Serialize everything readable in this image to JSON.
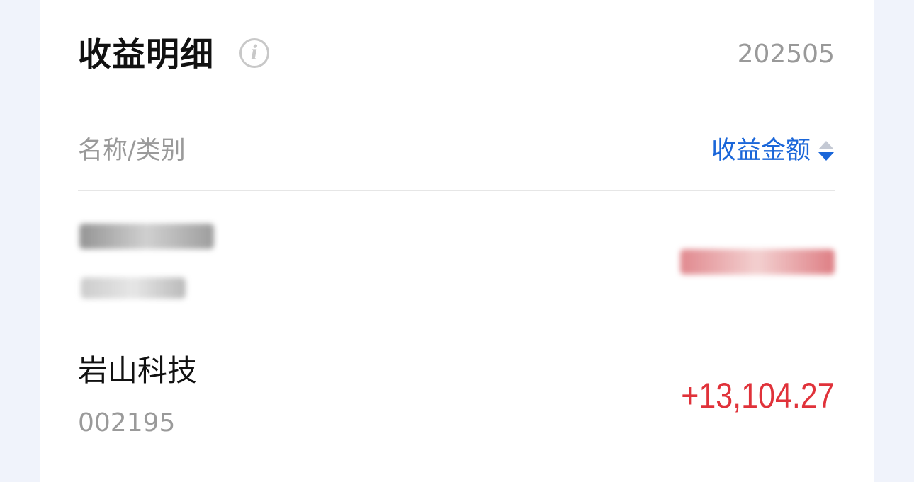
{
  "header": {
    "title": "收益明细",
    "info_icon": "info-icon",
    "period": "202505"
  },
  "columns": {
    "name_label": "名称/类别",
    "amount_label": "收益金额",
    "sort_icon": "sort-icon"
  },
  "rows": [
    {
      "name": "",
      "code": "",
      "value": "",
      "redacted": true
    },
    {
      "name": "岩山科技",
      "code": "002195",
      "value": "+13,104.27",
      "redacted": false
    }
  ],
  "colors": {
    "background": "#f0f3fb",
    "card": "#ffffff",
    "accent_blue": "#1a66d9",
    "gain_red": "#e0323a",
    "muted_text": "#9a9a9a"
  }
}
